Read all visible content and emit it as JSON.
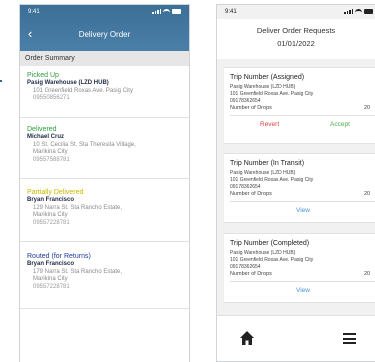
{
  "left": {
    "status_time": "9:41",
    "back_glyph": "‹",
    "title": "Delivery Order",
    "section": "Order Summary",
    "entries": [
      {
        "status": "Picked Up",
        "status_color": "#2e9e3e",
        "name": "Pasig Warehouse (LZD HUB)",
        "addr": [
          "101 Greenfield Roxas Ave. Pasig City"
        ],
        "phone": "09550856271"
      },
      {
        "status": "Delivered",
        "status_color": "#2e9e3e",
        "name": "Michael Cruz",
        "addr": [
          "10 St. Cecilia St. Sta Theresita Village,",
          "Marikina City"
        ],
        "phone": "09557588781"
      },
      {
        "status": "Partially Delivered",
        "status_color": "#c9b800",
        "name": "Bryan Francisco",
        "addr": [
          "129 Narra St. Sta Rancho Estate,",
          "Marikina City"
        ],
        "phone": "09557228781"
      },
      {
        "status": "Routed (for Returns)",
        "status_color": "#1f3a9a",
        "name": "Bryan Francisco",
        "addr": [
          "179 Narra St. Sta Rancho Estate,",
          "Marikina City"
        ],
        "phone": "09557228781"
      }
    ]
  },
  "right": {
    "status_time": "9:41",
    "title": "Deliver Order Requests",
    "date": "01/01/2022",
    "cards": [
      {
        "title": "Trip Number (Assigned)",
        "lines": [
          "Pasig Warehouse (LZD HUB)",
          "101 Greenfield Roxas Ave. Pasig City",
          "09178362654"
        ],
        "drops_label": "Number of Drops",
        "drops_value": "20",
        "actions": [
          "Revert",
          "Accept"
        ]
      },
      {
        "title": "Trip Number (In Transit)",
        "lines": [
          "Pasig Warehouse (LZD HUB)",
          "101 Greenfield Roxas Ave. Pasig City",
          "09178362654"
        ],
        "drops_label": "Number of Drops",
        "drops_value": "20",
        "actions": [
          "View"
        ]
      },
      {
        "title": "Trip Number (Completed)",
        "lines": [
          "Pasig Warehouse (LZD HUB)",
          "101 Greenfield Roxas Ave. Pasig City",
          "09178362654"
        ],
        "drops_label": "Number of Drops",
        "drops_value": "20",
        "actions": [
          "View"
        ]
      }
    ],
    "footer_icons": [
      "home-icon",
      "menu-icon"
    ]
  }
}
